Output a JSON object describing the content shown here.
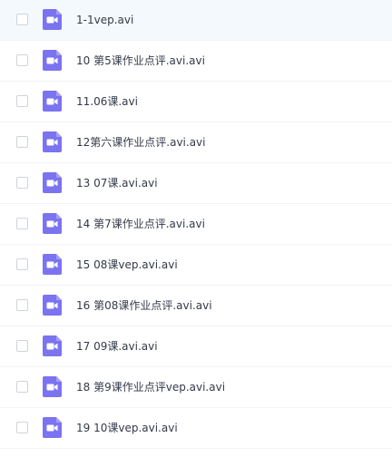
{
  "files": [
    {
      "name": "1-1vep.avi",
      "icon": "video-file-icon",
      "selected": true
    },
    {
      "name": "10 第5课作业点评.avi.avi",
      "icon": "video-file-icon",
      "selected": false
    },
    {
      "name": "11.06课.avi",
      "icon": "video-file-icon",
      "selected": false
    },
    {
      "name": "12第六课作业点评.avi.avi",
      "icon": "video-file-icon",
      "selected": false
    },
    {
      "name": "13 07课.avi.avi",
      "icon": "video-file-icon",
      "selected": false
    },
    {
      "name": "14 第7课作业点评.avi.avi",
      "icon": "video-file-icon",
      "selected": false
    },
    {
      "name": "15 08课vep.avi.avi",
      "icon": "video-file-icon",
      "selected": false
    },
    {
      "name": "16 第08课作业点评.avi.avi",
      "icon": "video-file-icon",
      "selected": false
    },
    {
      "name": "17 09课.avi.avi",
      "icon": "video-file-icon",
      "selected": false
    },
    {
      "name": "18 第9课作业点评vep.avi.avi",
      "icon": "video-file-icon",
      "selected": false
    },
    {
      "name": "19 10课vep.avi.avi",
      "icon": "video-file-icon",
      "selected": false
    }
  ],
  "colors": {
    "icon_bg": "#7b73f0",
    "icon_fold": "#a49ef6",
    "selected_row_bg": "#f4f9fe",
    "text": "#333a48"
  }
}
